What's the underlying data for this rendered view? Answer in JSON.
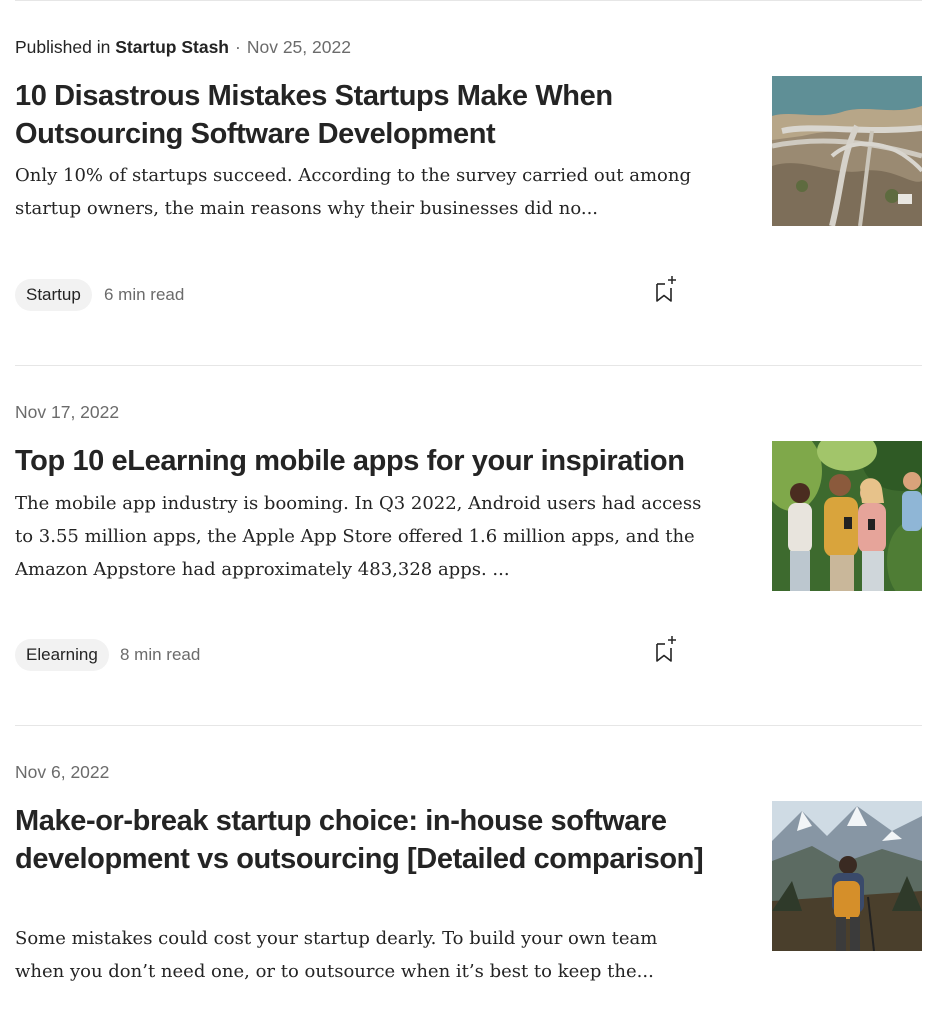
{
  "articles": [
    {
      "published_prefix": "Published in",
      "publication": "Startup Stash",
      "separator": "·",
      "date": "Nov 25, 2022",
      "title": "10 Disastrous Mistakes Startups Make When Outsourcing Software Development",
      "excerpt": "Only 10% of startups succeed. According to the survey carried out among startup owners, the main reasons why their businesses did no...",
      "tag": "Startup",
      "read_time": "6 min read",
      "thumbnail": "highway-interchange-aerial-image",
      "bookmark_icon": "bookmark-add-icon"
    },
    {
      "date": "Nov 17, 2022",
      "title": "Top 10 eLearning mobile apps for your inspiration",
      "excerpt": "The mobile app industry is booming. In Q3 2022, Android users had access to 3.55 million apps, the Apple App Store offered 1.6 million apps, and the Amazon Appstore had approximately 483,328 apps. ...",
      "tag": "Elearning",
      "read_time": "8 min read",
      "thumbnail": "people-with-phones-image",
      "bookmark_icon": "bookmark-add-icon"
    },
    {
      "date": "Nov 6, 2022",
      "title": "Make-or-break startup choice: in-house software development vs outsourcing [Detailed comparison]",
      "excerpt": "Some mistakes could cost your startup dearly. To build your own team when you don’t need one, or to outsource when it’s best to keep the...",
      "thumbnail": "hiker-mountains-image"
    }
  ],
  "colors": {
    "text_primary": "#242424",
    "text_secondary": "#6b6b6b",
    "tag_background": "#f2f2f2",
    "divider": "#e6e6e6"
  }
}
